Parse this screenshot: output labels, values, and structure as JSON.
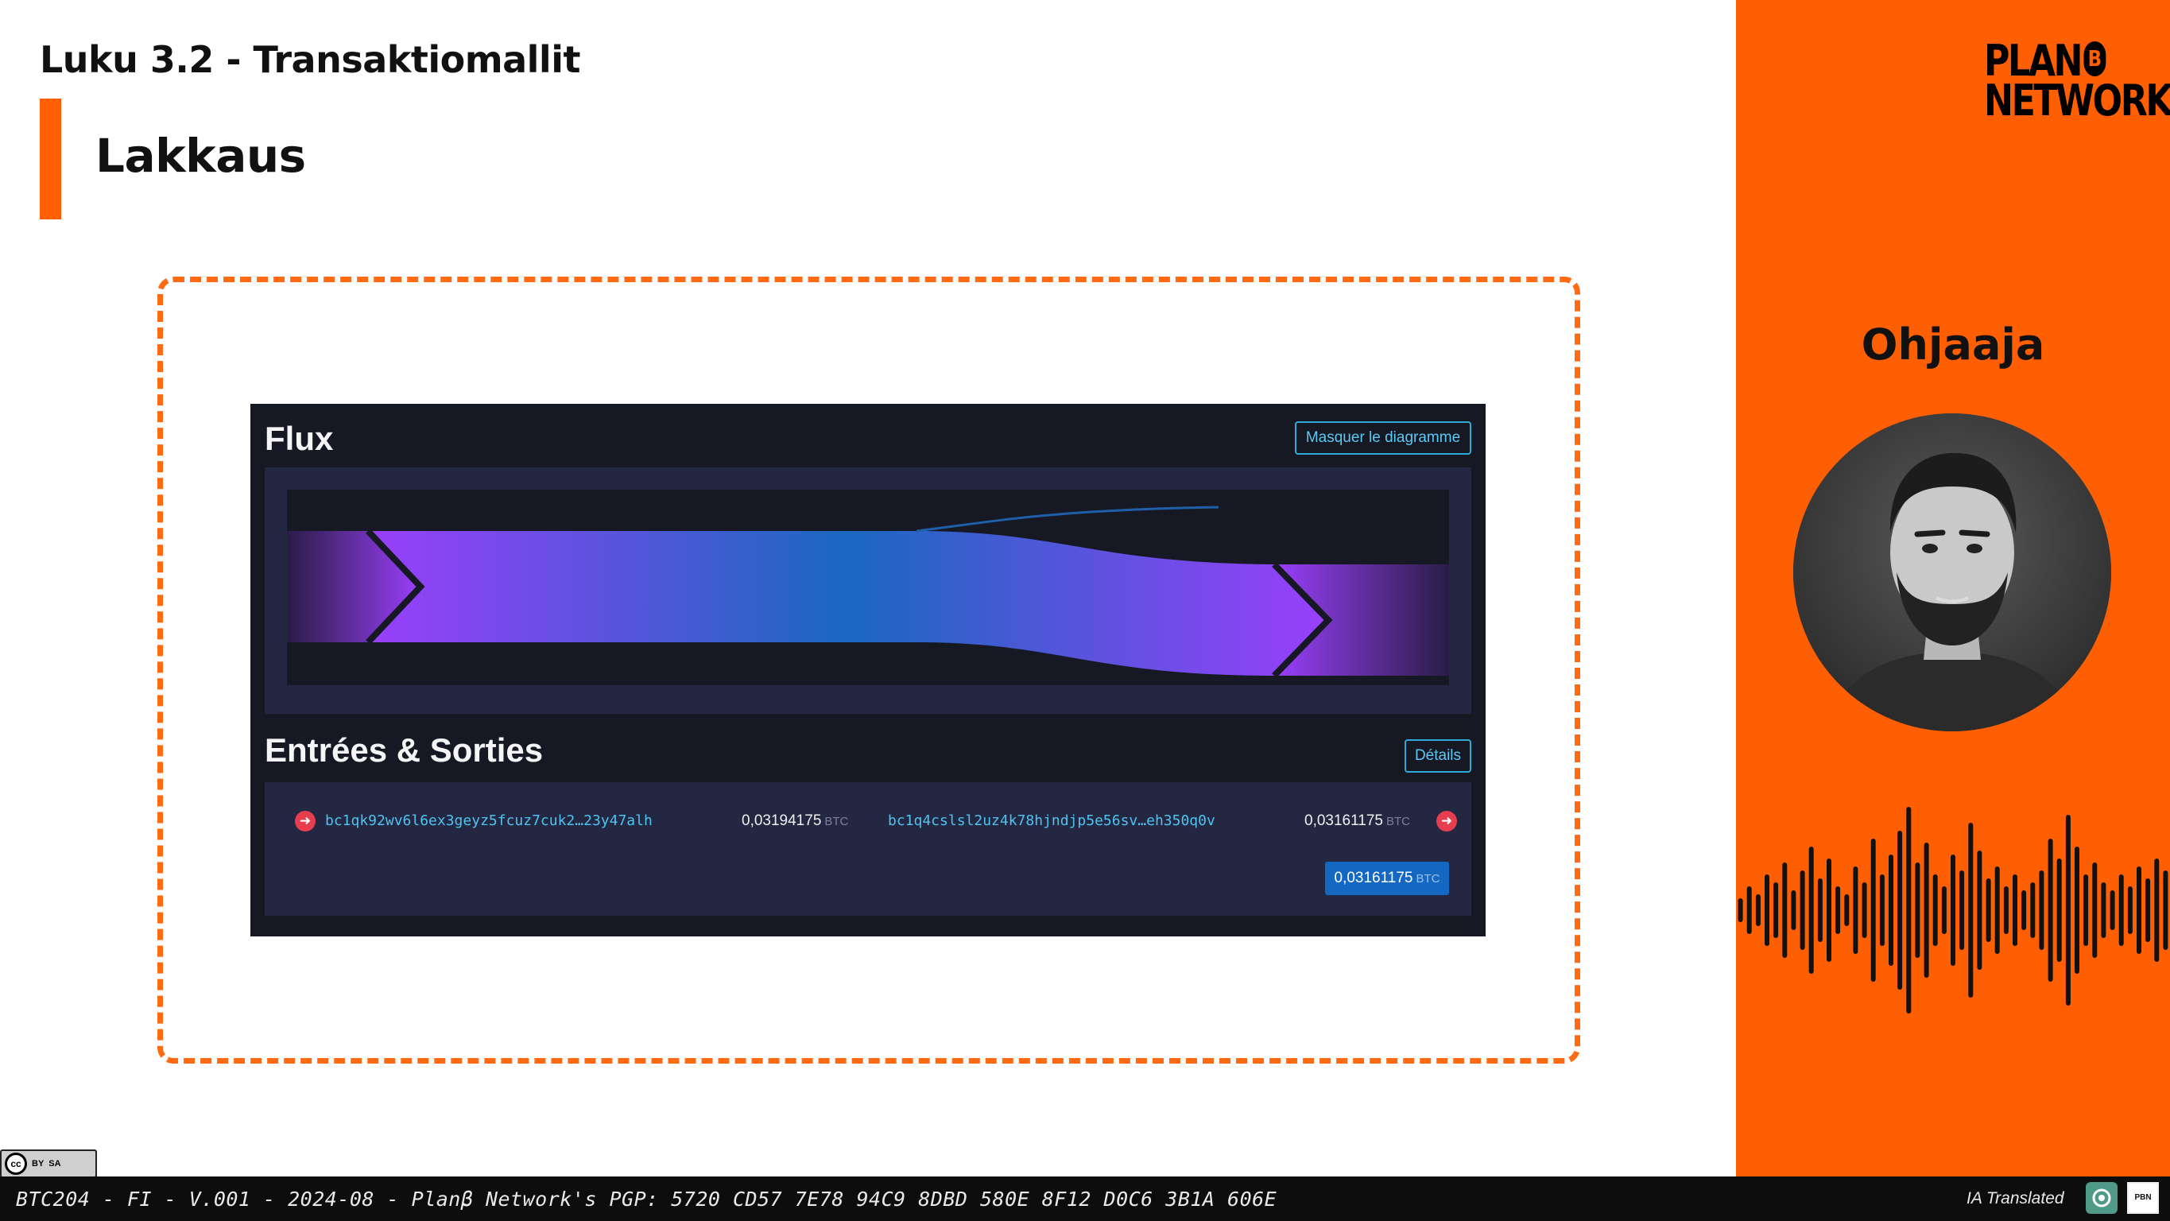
{
  "slide": {
    "chapter": "Luku 3.2 - Transaktiomallit",
    "title": "Lakkaus"
  },
  "screenshot": {
    "flux": {
      "title": "Flux",
      "hide_button": "Masquer le diagramme"
    },
    "io": {
      "title": "Entrées & Sorties",
      "details_button": "Détails",
      "input": {
        "address": "bc1qk92wv6l6ex3geyz5fcuz7cuk2…23y47alh",
        "amount": "0,03194175",
        "unit": "BTC"
      },
      "output": {
        "address": "bc1q4cslsl2uz4k78hjndjp5e56sv…eh350q0v",
        "amount": "0,03161175",
        "unit": "BTC"
      },
      "total": {
        "amount": "0,03161175",
        "unit": "BTC"
      }
    }
  },
  "sidebar": {
    "logo_line1": "PLAN",
    "logo_b": "B",
    "logo_line2": "NETWORK",
    "presenter_label": "Ohjaaja"
  },
  "footer": {
    "pgp": "BTC204 - FI - V.001 - 2024-08 - Planβ Network's PGP: 5720 CD57 7E78 94C9 8DBD 580E 8F12 D0C6 3B1A 606E",
    "ia_label": "IA Translated",
    "license": "cc by sa",
    "license_by": "BY",
    "license_sa": "SA"
  },
  "colors": {
    "accent": "#ff5f03",
    "screenshot_bg": "#161923",
    "panel_bg": "#232742",
    "link": "#4fc3ef",
    "flow_purple": "#9a3ffb",
    "flow_blue": "#1a68bf"
  }
}
